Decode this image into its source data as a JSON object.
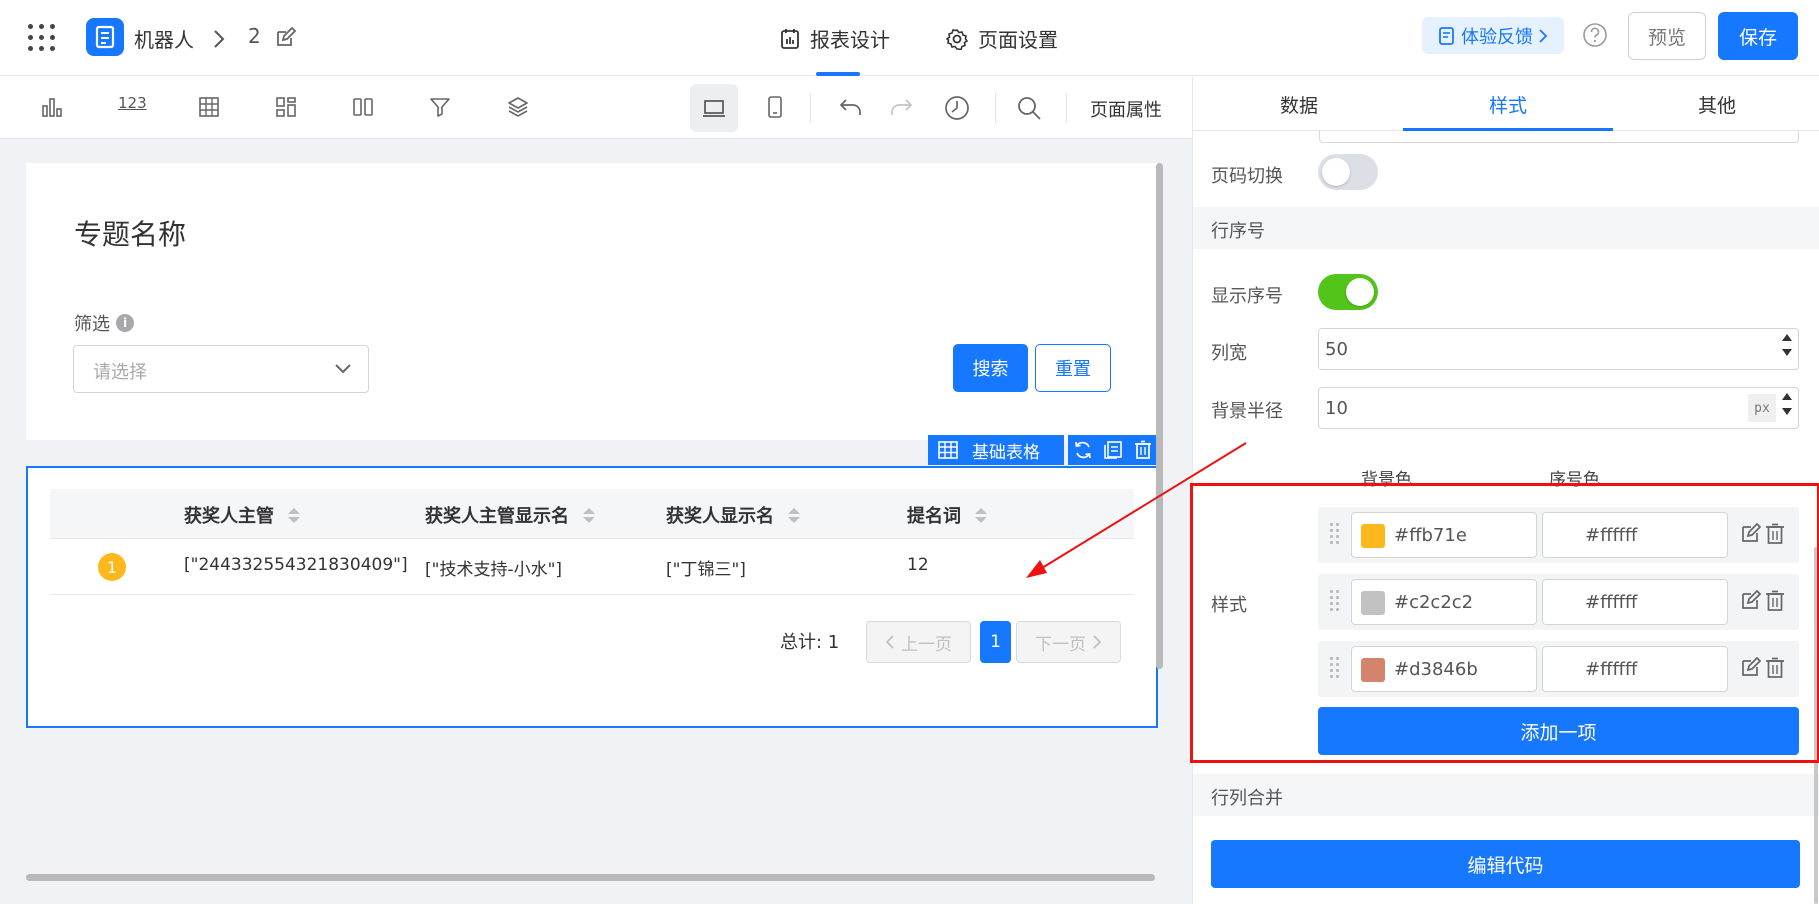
{
  "header": {
    "app_name": "机器人",
    "breadcrumb_page": "2",
    "tabs": [
      {
        "label": "报表设计",
        "active": true
      },
      {
        "label": "页面设置",
        "active": false
      }
    ],
    "feedback_label": "体验反馈",
    "preview_label": "预览",
    "save_label": "保存"
  },
  "toolbar": {
    "icons": [
      "chart-icon",
      "number-icon",
      "table-icon",
      "widgets-icon",
      "columns-icon",
      "filter-icon",
      "layers-icon",
      "desktop-icon",
      "mobile-icon",
      "undo-icon",
      "redo-icon",
      "history-icon",
      "search-icon"
    ],
    "number_icon_text": "123",
    "page_props_label": "页面属性"
  },
  "canvas": {
    "page_title": "专题名称",
    "filter_label": "筛选",
    "info_glyph": "i",
    "filter_placeholder": "请选择",
    "search_label": "搜索",
    "reset_label": "重置",
    "component_tag": "基础表格",
    "table": {
      "columns": [
        "获奖人主管",
        "获奖人主管显示名",
        "获奖人显示名",
        "提名词"
      ],
      "rows": [
        {
          "index": "1",
          "cells": [
            "[\"244332554321830409\"]",
            "[\"技术支持-小水\"]",
            "[\"丁锦三\"]",
            "12"
          ]
        }
      ]
    },
    "pagination": {
      "total_label": "总计: 1",
      "prev_label": "上一页",
      "current_page": "1",
      "next_label": "下一页"
    }
  },
  "panel": {
    "tabs": [
      {
        "label": "数据",
        "active": false
      },
      {
        "label": "样式",
        "active": true
      },
      {
        "label": "其他",
        "active": false
      }
    ],
    "page_switch_label": "页码切换",
    "page_switch_on": false,
    "row_number_section": "行序号",
    "show_index_label": "显示序号",
    "show_index_on": true,
    "col_width_label": "列宽",
    "col_width_value": "50",
    "bg_radius_label": "背景半径",
    "bg_radius_value": "10",
    "bg_radius_unit": "px",
    "bg_color_header": "背景色",
    "index_color_header": "序号色",
    "style_label": "样式",
    "styles": [
      {
        "bg": "#ffb71e",
        "fg": "#ffffff"
      },
      {
        "bg": "#c2c2c2",
        "fg": "#ffffff"
      },
      {
        "bg": "#d3846b",
        "fg": "#ffffff"
      }
    ],
    "add_item_label": "添加一项",
    "merge_section": "行列合并",
    "edit_code_label": "编辑代码"
  },
  "colors": {
    "primary": "#1677ff",
    "toggle_on": "#52c41a",
    "toggle_off": "#dcdfe6",
    "annotation": "#ee1111"
  }
}
